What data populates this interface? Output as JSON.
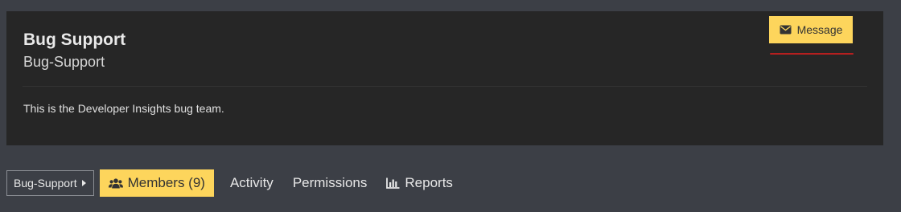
{
  "group": {
    "title": "Bug Support",
    "handle": "Bug-Support",
    "description": "This is the Developer Insights bug team."
  },
  "actions": {
    "message_label": "Message",
    "message_icon": "envelope-icon"
  },
  "nav": {
    "breadcrumb_label": "Bug-Support",
    "tabs": [
      {
        "label": "Members (9)",
        "icon": "users-icon",
        "active": true
      },
      {
        "label": "Activity"
      },
      {
        "label": "Permissions"
      },
      {
        "label": "Reports",
        "icon": "bar-chart-icon"
      }
    ]
  },
  "colors": {
    "page_bg": "#3c3f46",
    "card_bg": "#262626",
    "accent": "#fdd55c",
    "underline_red": "#b51f1f"
  }
}
